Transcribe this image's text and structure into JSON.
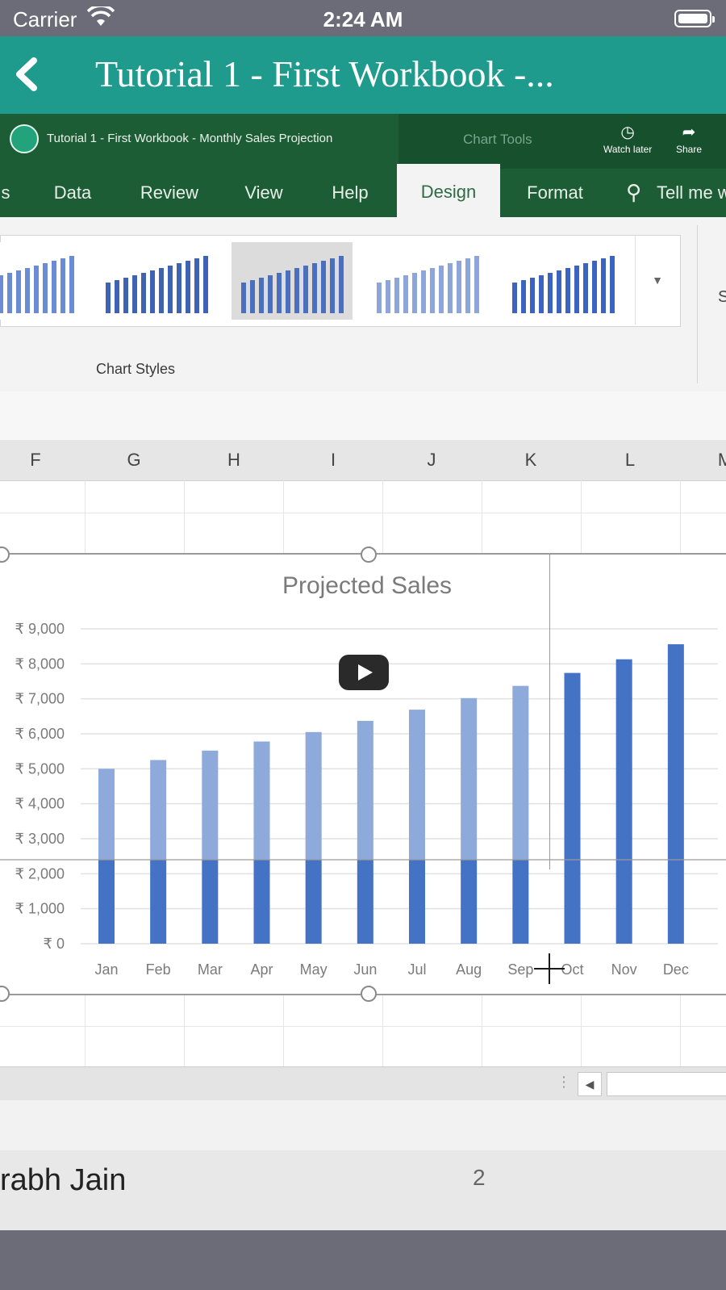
{
  "status_bar": {
    "carrier": "Carrier",
    "time": "2:24 AM"
  },
  "nav": {
    "title": "Tutorial 1 - First Workbook -..."
  },
  "video": {
    "excel": {
      "window_title": "Tutorial 1 - First Workbook - Monthly Sales Projection",
      "context_tab_group": "Chart Tools",
      "youtube_buttons": {
        "watch_later": "Watch later",
        "share": "Share"
      },
      "ribbon_tabs": [
        "s",
        "Data",
        "Review",
        "View",
        "Help",
        "Design",
        "Format",
        "Tell me w"
      ],
      "active_tab": "Design",
      "ribbon_group_label": "Chart Styles",
      "ribbon_cut_text": "S",
      "column_headers": [
        "F",
        "G",
        "H",
        "I",
        "J",
        "K",
        "L",
        "M"
      ]
    },
    "author": "rabh Jain",
    "page_number": "2"
  },
  "colors": {
    "teal_nav": "#1f9b8e",
    "excel_green": "#1d5d36",
    "bar_dark": "#4472c4",
    "bar_light": "#8eaadb"
  },
  "chart_data": {
    "type": "bar",
    "title": "Projected Sales",
    "categories": [
      "Jan",
      "Feb",
      "Mar",
      "Apr",
      "May",
      "Jun",
      "Jul",
      "Aug",
      "Sep",
      "Oct",
      "Nov",
      "Dec"
    ],
    "values": [
      5000,
      5250,
      5520,
      5780,
      6050,
      6370,
      6690,
      7020,
      7370,
      7740,
      8130,
      8560
    ],
    "base_band": 2400,
    "highlighted_months": [
      "Oct",
      "Nov",
      "Dec"
    ],
    "y_ticks": [
      "₹ 9,000",
      "₹ 8,000",
      "₹ 7,000",
      "₹ 6,000",
      "₹ 5,000",
      "₹ 4,000",
      "₹ 3,000",
      "₹ 2,000",
      "₹ 1,000",
      "₹ 0"
    ],
    "ylim": [
      0,
      9000
    ],
    "grid": true
  }
}
